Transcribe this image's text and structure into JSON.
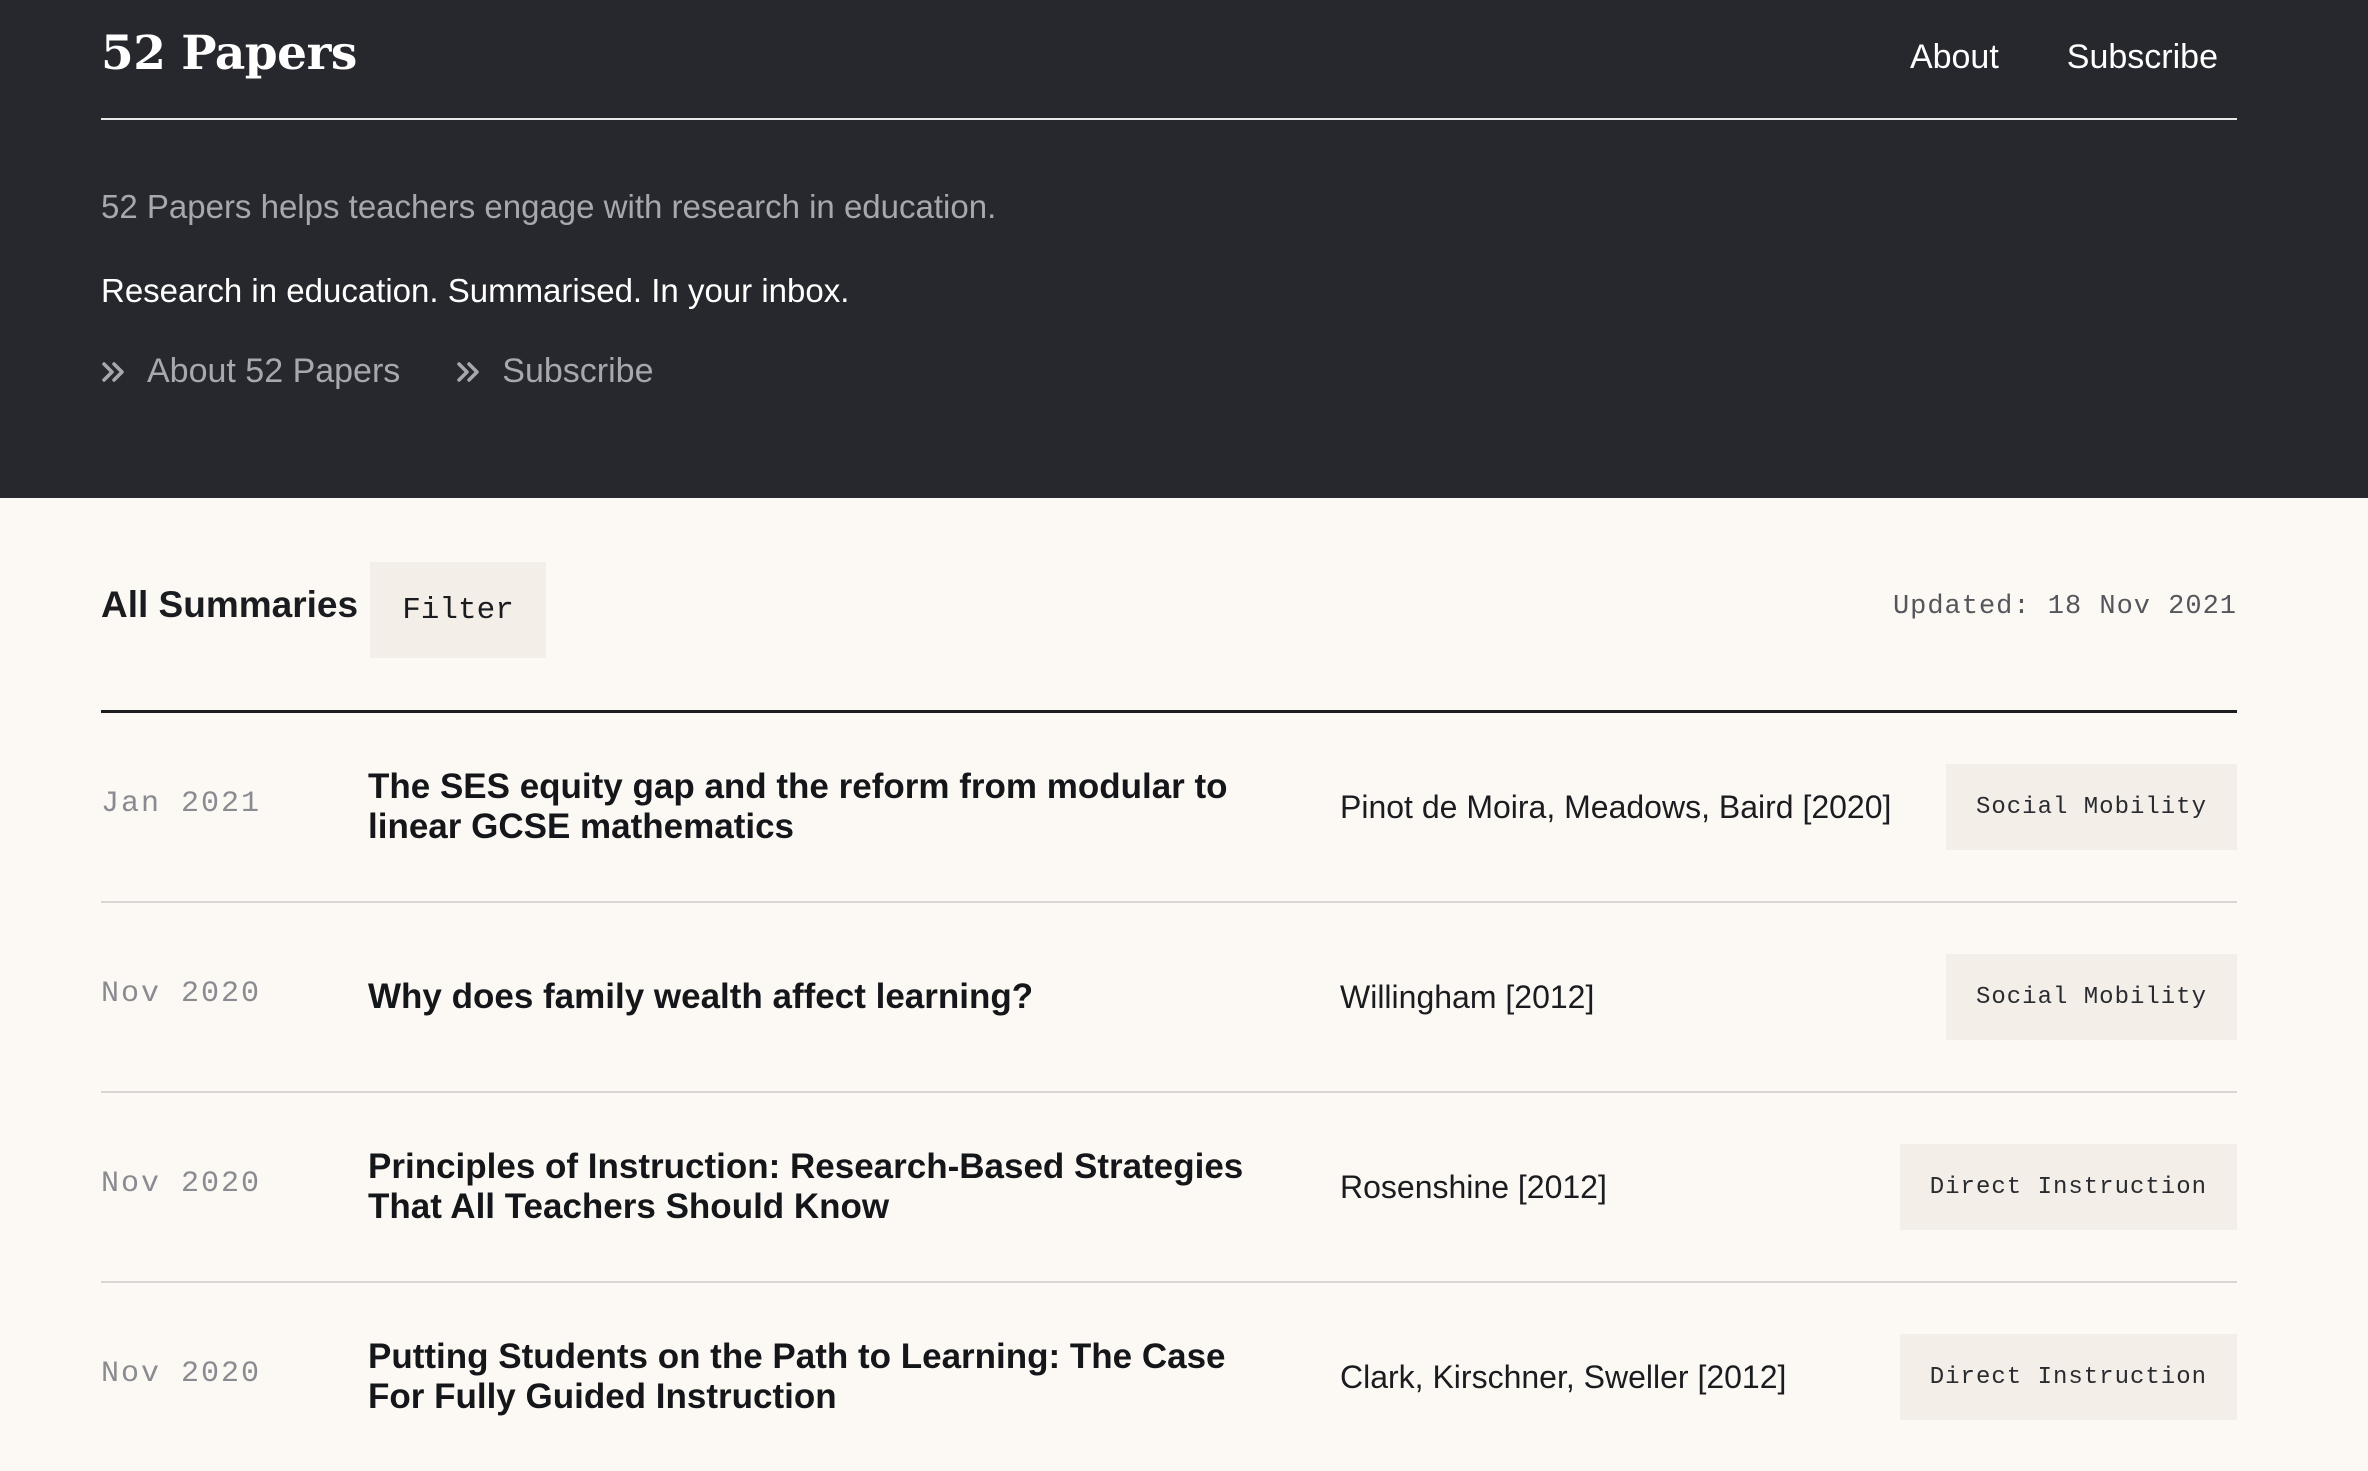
{
  "header": {
    "logo": "52 Papers",
    "nav": {
      "about": "About",
      "subscribe": "Subscribe"
    }
  },
  "hero": {
    "tagline": "52 Papers helps teachers engage with research in education.",
    "strap": "Research in education. Summarised. In your inbox.",
    "links": {
      "about": "About 52 Papers",
      "subscribe": "Subscribe"
    }
  },
  "summaries": {
    "heading": "All Summaries",
    "filter_label": "Filter",
    "updated": "Updated: 18 Nov 2021",
    "rows": [
      {
        "date": "Jan 2021",
        "title": "The SES equity gap and the reform from modular to linear GCSE mathematics",
        "authors": "Pinot de Moira, Meadows, Baird [2020]",
        "tag": "Social Mobility"
      },
      {
        "date": "Nov 2020",
        "title": "Why does family wealth affect learning?",
        "authors": "Willingham [2012]",
        "tag": "Social Mobility"
      },
      {
        "date": "Nov 2020",
        "title": "Principles of Instruction: Research-Based Strategies That All Teachers Should Know",
        "authors": "Rosenshine [2012]",
        "tag": "Direct Instruction"
      },
      {
        "date": "Nov 2020",
        "title": "Putting Students on the Path to Learning: The Case For Fully Guided Instruction",
        "authors": "Clark, Kirschner, Sweller [2012]",
        "tag": "Direct Instruction"
      }
    ]
  }
}
